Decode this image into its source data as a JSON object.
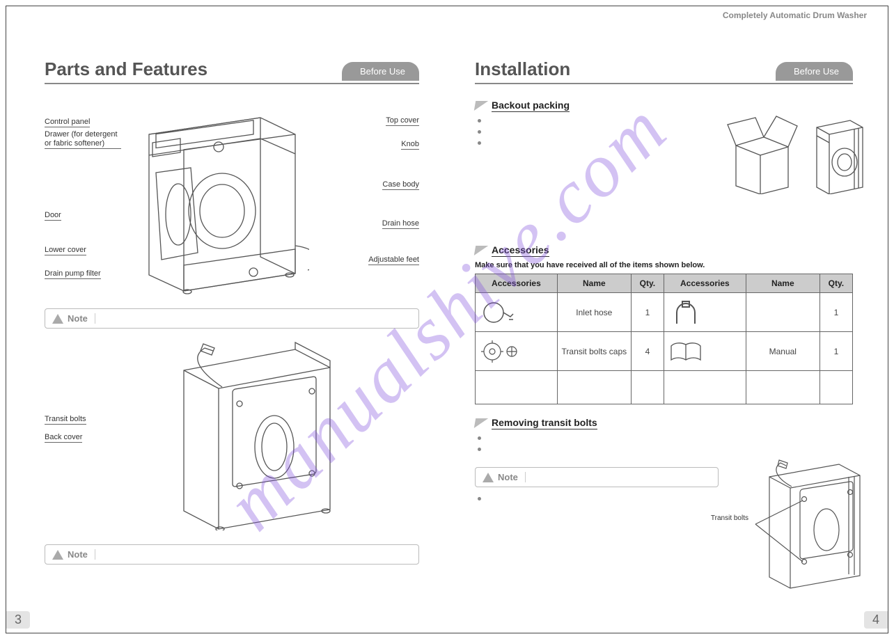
{
  "doc_title": "Completely Automatic Drum Washer",
  "watermark": "manualshive.com",
  "left": {
    "title": "Parts and Features",
    "badge": "Before Use",
    "callouts_front": {
      "control_panel": "Control panel",
      "drawer": "Drawer (for detergent or fabric softener)",
      "door": "Door",
      "lower_cover": "Lower cover",
      "drain_pump_filter": "Drain pump filter",
      "top_cover": "Top cover",
      "knob": "Knob",
      "case_body": "Case body",
      "drain_hose": "Drain hose",
      "adjustable_feet": "Adjustable feet"
    },
    "callouts_back": {
      "transit_bolts": "Transit bolts",
      "back_cover": "Back cover"
    },
    "note_label": "Note",
    "page_num": "3"
  },
  "right": {
    "title": "Installation",
    "badge": "Before Use",
    "sub1": "Backout packing",
    "sub2": "Accessories",
    "acc_intro": "Make sure that you have received all of the items shown below.",
    "table": {
      "headers": [
        "Accessories",
        "Name",
        "Qty.",
        "Accessories",
        "Name",
        "Qty."
      ],
      "rows": [
        {
          "name1": "Inlet hose",
          "qty1": "1",
          "name2": "",
          "qty2": "1"
        },
        {
          "name1": "Transit bolts caps",
          "qty1": "4",
          "name2": "Manual",
          "qty2": "1"
        }
      ]
    },
    "sub3": "Removing transit  bolts",
    "note_label": "Note",
    "back_callout": "Transit bolts",
    "page_num": "4"
  }
}
